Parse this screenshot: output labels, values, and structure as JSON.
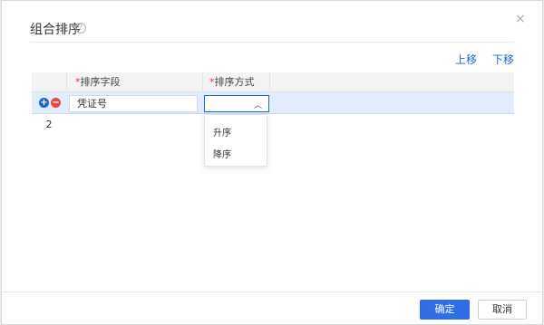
{
  "dialog": {
    "title": "组合排序",
    "help_icon": "?",
    "close_icon": "×"
  },
  "toolbar": {
    "move_up": "上移",
    "move_down": "下移"
  },
  "table": {
    "headers": {
      "required_mark": "*",
      "field": "排序字段",
      "method": "排序方式"
    },
    "rows": [
      {
        "field_value": "凭证号",
        "method_value": ""
      },
      {
        "number": "2"
      }
    ]
  },
  "dropdown": {
    "options": [
      "升序",
      "降序"
    ]
  },
  "footer": {
    "ok": "确定",
    "cancel": "取消"
  },
  "colors": {
    "primary": "#2f6ee6",
    "danger": "#e24a4a",
    "selected_row": "#e1ecff"
  }
}
